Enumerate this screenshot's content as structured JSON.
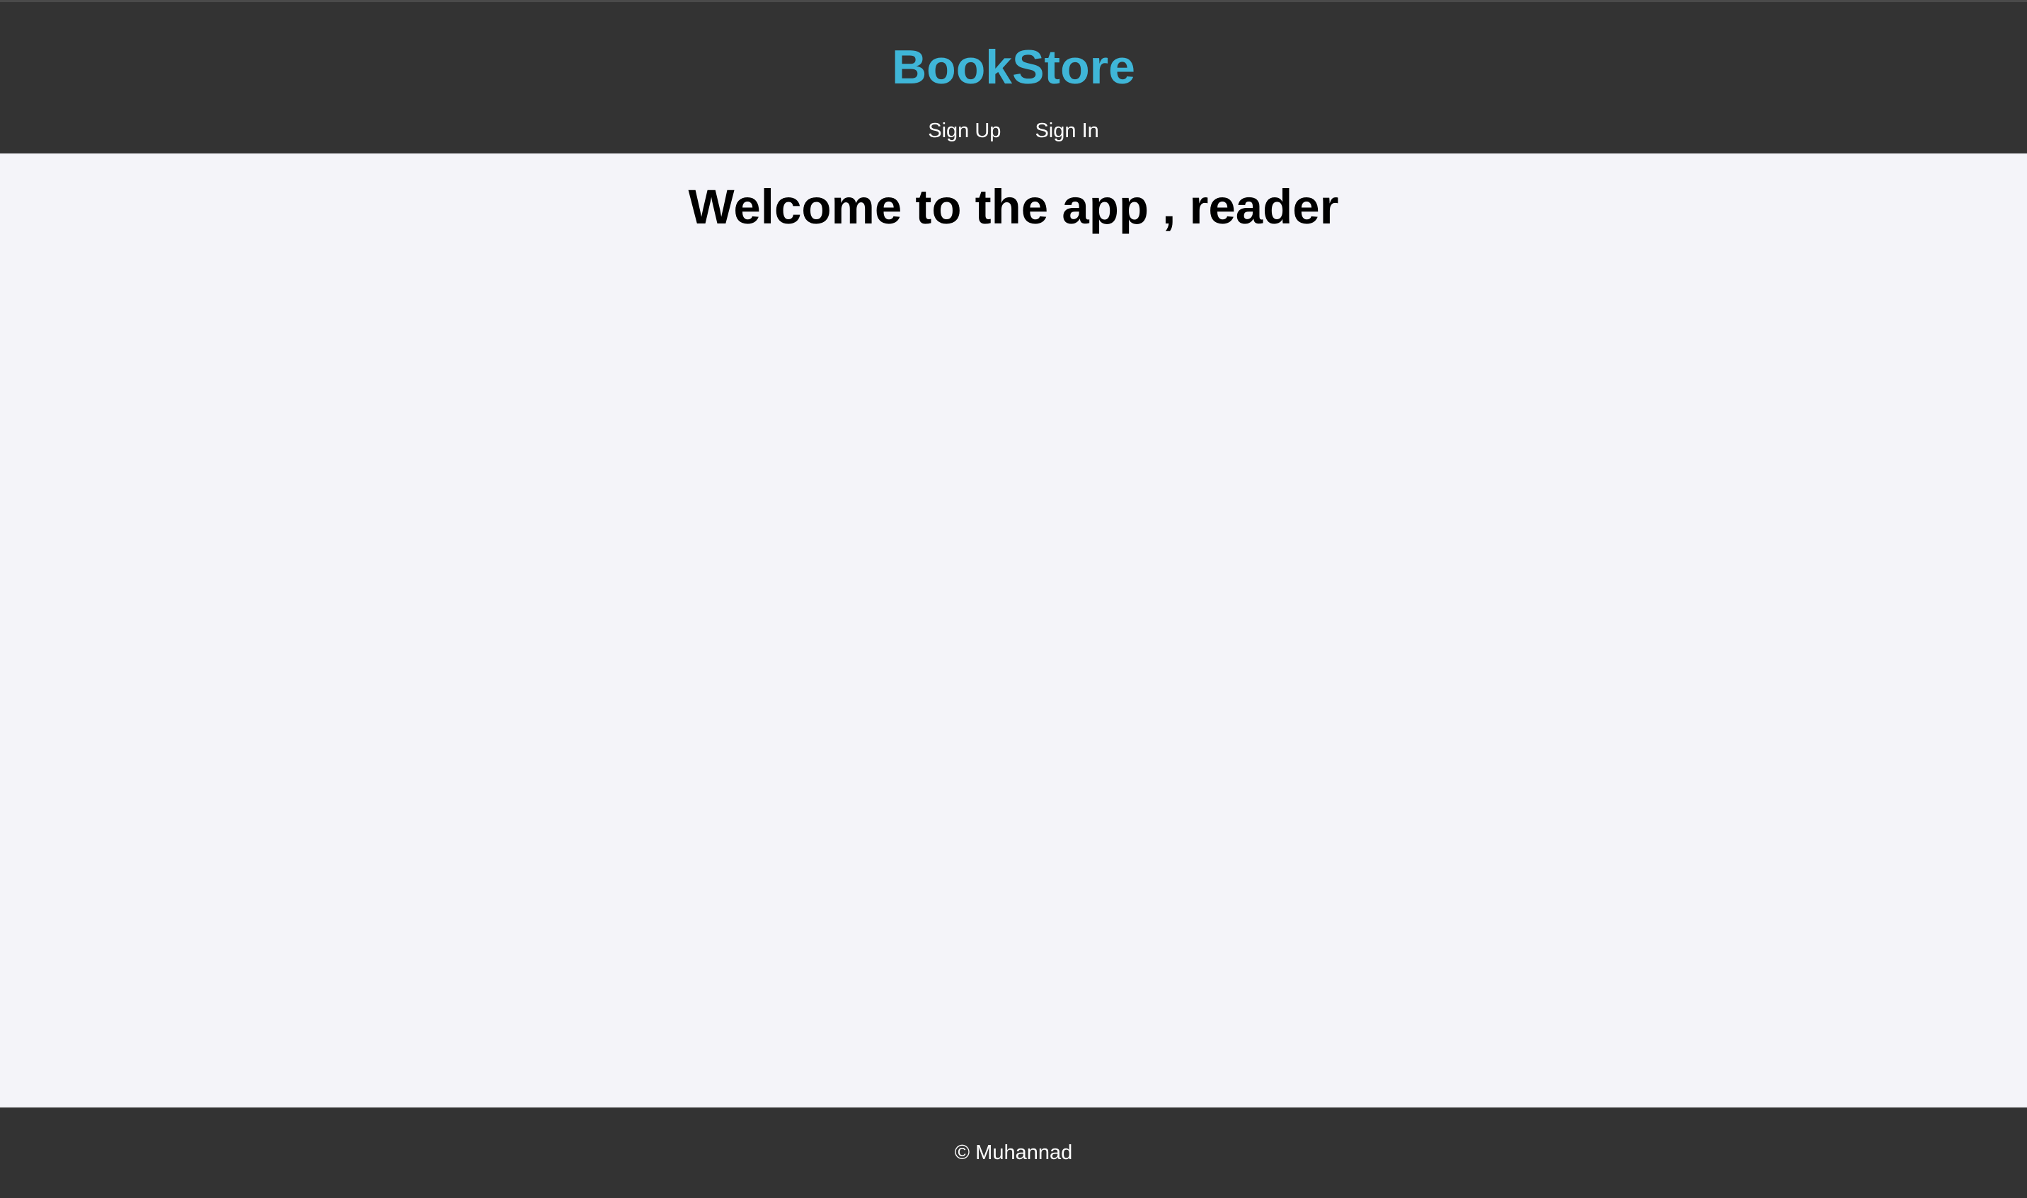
{
  "header": {
    "brand": "BookStore",
    "nav": [
      {
        "label": "Sign Up"
      },
      {
        "label": "Sign In"
      }
    ]
  },
  "main": {
    "welcome": "Welcome to the app , reader"
  },
  "footer": {
    "text": "© Muhannad"
  },
  "colors": {
    "header_bg": "#333333",
    "brand": "#3fb6d8",
    "page_bg": "#f4f4f9",
    "nav_text": "#ffffff"
  }
}
